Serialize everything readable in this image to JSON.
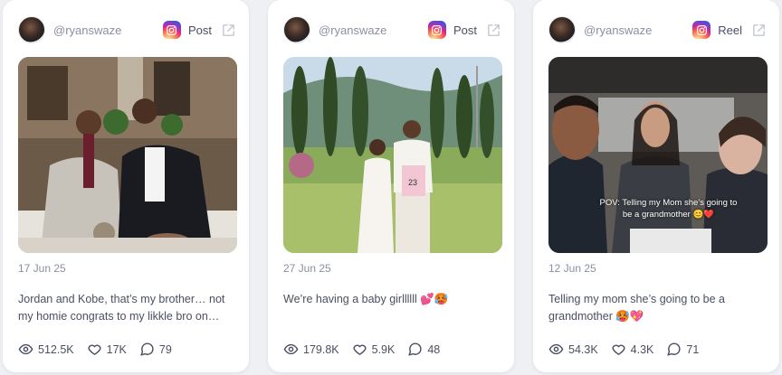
{
  "colors": {
    "card_bg": "#ffffff",
    "page_bg": "#eef0f4",
    "text_muted": "#8a8fa3",
    "text_main": "#4a4f63"
  },
  "posts": [
    {
      "handle": "@ryanswaze",
      "platform_icon": "instagram-icon",
      "type": "Post",
      "date": "17 Jun 25",
      "caption": "Jordan and Kobe, that’s my brother… not my homie congrats to my likkle bro on…",
      "views": "512.5K",
      "likes": "17K",
      "comments": "79"
    },
    {
      "handle": "@ryanswaze",
      "platform_icon": "instagram-icon",
      "type": "Post",
      "date": "27 Jun 25",
      "caption": "We’re having a baby girllllll 💕🥵",
      "views": "179.8K",
      "likes": "5.9K",
      "comments": "48"
    },
    {
      "handle": "@ryanswaze",
      "platform_icon": "instagram-icon",
      "type": "Reel",
      "date": "12 Jun 25",
      "caption": "Telling my mom she’s going to be a grandmother 🥵💖",
      "overlay_text": "POV: Telling my Mom she’s going to be a grandmother 😊❤️",
      "views": "54.3K",
      "likes": "4.3K",
      "comments": "71"
    }
  ]
}
